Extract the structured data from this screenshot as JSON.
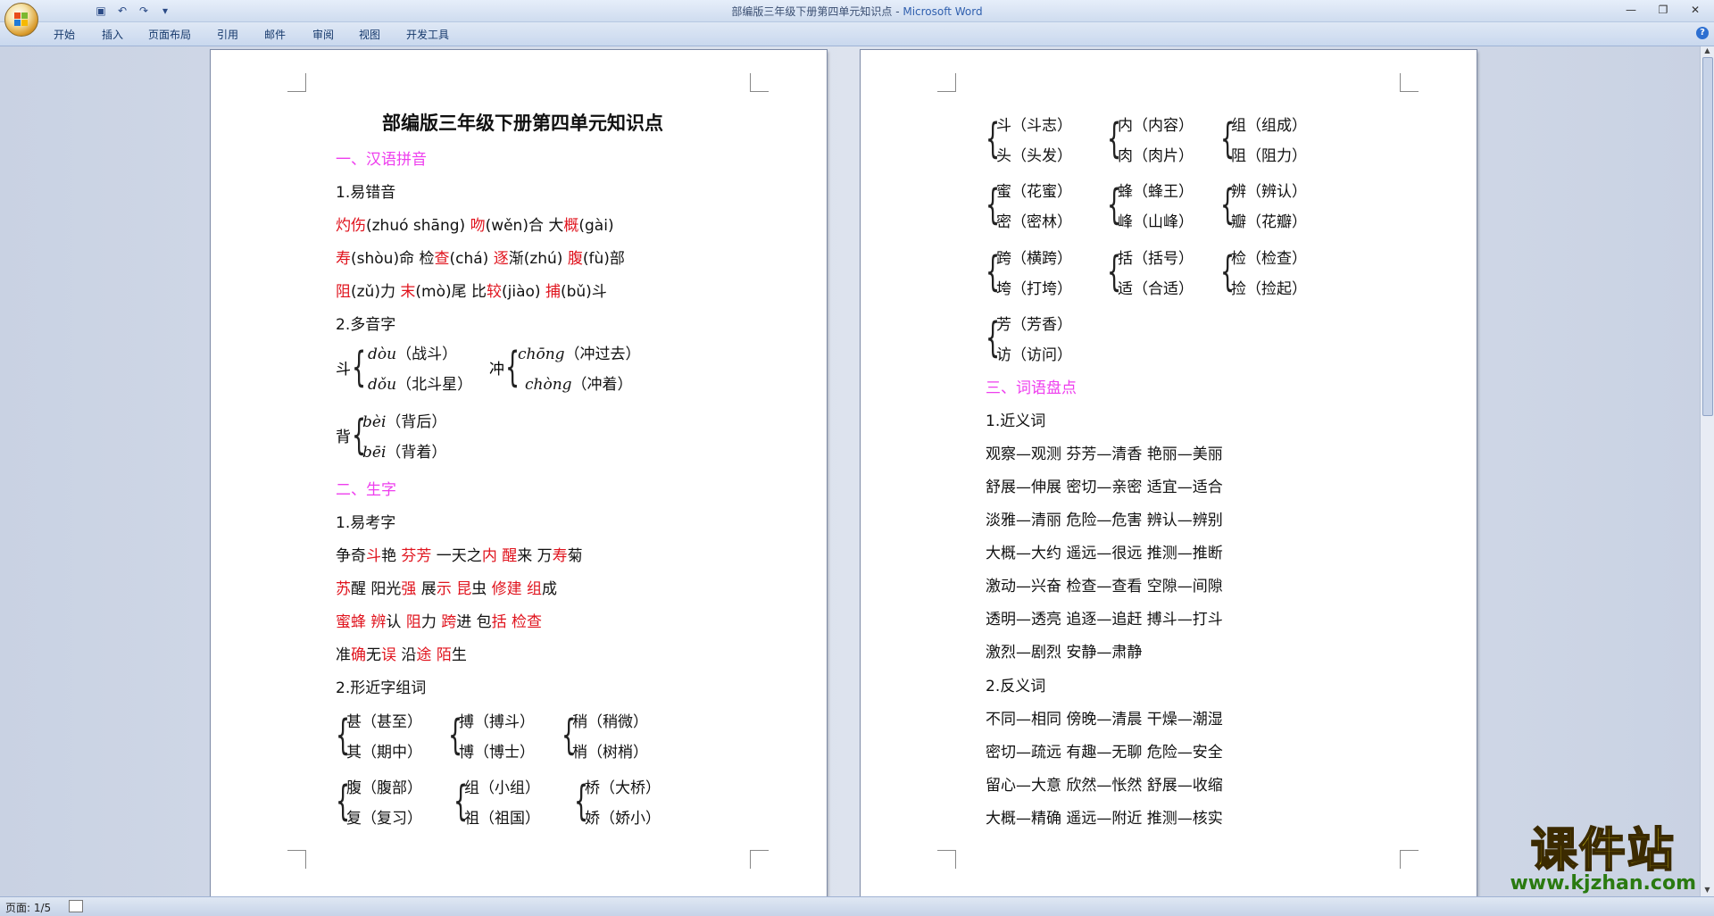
{
  "window": {
    "title": "部编版三年级下册第四单元知识点",
    "title_sep": " - ",
    "app_name": "Microsoft Word"
  },
  "quick_access": {
    "save_icon": "save-icon",
    "undo_icon": "undo-icon",
    "redo_icon": "redo-icon",
    "more": "▾"
  },
  "ribbon_tabs": [
    "开始",
    "插入",
    "页面布局",
    "引用",
    "邮件",
    "审阅",
    "视图",
    "开发工具"
  ],
  "page1": {
    "heading": "部编版三年级下册第四单元知识点",
    "s1": "一、汉语拼音",
    "s1_1": "1.易错音",
    "r1": [
      [
        "灼伤",
        "r"
      ],
      [
        "(zhuó shāng)   ",
        ""
      ],
      [
        "吻",
        "r"
      ],
      [
        "(wěn)合   大",
        ""
      ],
      [
        "概",
        "r"
      ],
      [
        "(gài)",
        ""
      ]
    ],
    "r2": [
      [
        "寿",
        "r"
      ],
      [
        "(shòu)命   检",
        ""
      ],
      [
        "查",
        "r"
      ],
      [
        "(chá)   ",
        ""
      ],
      [
        "逐",
        "r"
      ],
      [
        "渐(zhú)   ",
        ""
      ],
      [
        "腹",
        "r"
      ],
      [
        "(fù)部",
        ""
      ]
    ],
    "r3": [
      [
        "阻",
        "r"
      ],
      [
        "(zǔ)力   ",
        ""
      ],
      [
        "末",
        "r"
      ],
      [
        "(mò)尾   比",
        ""
      ],
      [
        "较",
        "r"
      ],
      [
        "(jiào)   ",
        ""
      ],
      [
        "捕",
        "r"
      ],
      [
        "(bǔ)斗",
        ""
      ]
    ],
    "s1_2": "2.多音字",
    "poly": [
      {
        "prefix": "斗",
        "a": "dòu",
        "a_word": "（战斗）",
        "b": "dǒu",
        "b_word": "（北斗星）"
      },
      {
        "prefix": "冲",
        "a": "chōng",
        "a_word": "（冲过去）",
        "b": "chòng",
        "b_word": "（冲着）"
      },
      {
        "prefix": "背",
        "a": "bèi",
        "a_word": "（背后）",
        "b": "bēi",
        "b_word": "（背着）"
      }
    ],
    "s2": "二、生字",
    "s2_1": "1.易考字",
    "k1": [
      [
        "争奇",
        ""
      ],
      [
        "斗",
        "r"
      ],
      [
        "艳   ",
        ""
      ],
      [
        "芬芳",
        "r"
      ],
      [
        "   一天之",
        ""
      ],
      [
        "内",
        "r"
      ],
      [
        "   ",
        ""
      ],
      [
        "醒",
        "r"
      ],
      [
        "来   万",
        ""
      ],
      [
        "寿",
        "r"
      ],
      [
        "菊",
        ""
      ]
    ],
    "k2": [
      [
        "苏",
        "r"
      ],
      [
        "醒   阳光",
        ""
      ],
      [
        "强",
        "r"
      ],
      [
        "   展",
        ""
      ],
      [
        "示",
        "r"
      ],
      [
        "   ",
        ""
      ],
      [
        "昆",
        "r"
      ],
      [
        "虫   ",
        ""
      ],
      [
        "修建",
        "r"
      ],
      [
        "   ",
        ""
      ],
      [
        "组",
        "r"
      ],
      [
        "成",
        ""
      ]
    ],
    "k3": [
      [
        "蜜蜂",
        "r"
      ],
      [
        "   ",
        ""
      ],
      [
        "辨",
        "r"
      ],
      [
        "认   ",
        ""
      ],
      [
        "阻",
        "r"
      ],
      [
        "力   ",
        ""
      ],
      [
        "跨",
        "r"
      ],
      [
        "进   包",
        ""
      ],
      [
        "括",
        "r"
      ],
      [
        "   ",
        ""
      ],
      [
        "检查",
        "r"
      ]
    ],
    "k4": [
      [
        "准",
        ""
      ],
      [
        "确",
        "r"
      ],
      [
        "无",
        ""
      ],
      [
        "误",
        "r"
      ],
      [
        "   沿",
        ""
      ],
      [
        "途",
        "r"
      ],
      [
        "   ",
        ""
      ],
      [
        "陌",
        "r"
      ],
      [
        "生",
        ""
      ]
    ],
    "s2_2": "2.形近字组词",
    "similar1": [
      {
        "a": "甚（甚至）",
        "b": "其（期中）"
      },
      {
        "a": "搏（搏斗）",
        "b": "博（博士）"
      },
      {
        "a": "稍（稍微）",
        "b": "梢（树梢）"
      }
    ],
    "similar2": [
      {
        "a": "腹（腹部）",
        "b": "复（复习）"
      },
      {
        "a": "组（小组）",
        "b": "祖（祖国）"
      },
      {
        "a": "桥（大桥）",
        "b": "娇（娇小）"
      }
    ]
  },
  "page2": {
    "groups": [
      [
        {
          "a": "斗（斗志）",
          "b": "头（头发）"
        },
        {
          "a": "内（内容）",
          "b": "肉（肉片）"
        },
        {
          "a": "组（组成）",
          "b": "阻（阻力）"
        }
      ],
      [
        {
          "a": "蜜（花蜜）",
          "b": "密（密林）"
        },
        {
          "a": "蜂（蜂王）",
          "b": "峰（山峰）"
        },
        {
          "a": "辨（辨认）",
          "b": "瓣（花瓣）"
        }
      ],
      [
        {
          "a": "跨（横跨）",
          "b": "垮（打垮）"
        },
        {
          "a": "括（括号）",
          "b": "适（合适）"
        },
        {
          "a": "检（检查）",
          "b": "捡（捡起）"
        }
      ],
      [
        {
          "a": "芳（芳香）",
          "b": "访（访问）"
        }
      ]
    ],
    "s3": "三、词语盘点",
    "s3_1": "1.近义词",
    "syn": [
      "观察—观测   芬芳—清香   艳丽—美丽",
      "舒展—伸展   密切—亲密   适宜—适合",
      "淡雅—清丽   危险—危害   辨认—辨别",
      "大概—大约   遥远—很远   推测—推断",
      "激动—兴奋   检查—查看   空隙—间隙",
      "透明—透亮   追逐—追赶   搏斗—打斗",
      "激烈—剧烈   安静—肃静"
    ],
    "s3_2": "2.反义词",
    "ant": [
      "不同—相同   傍晚—清晨   干燥—潮湿",
      "密切—疏远   有趣—无聊   危险—安全",
      "留心—大意   欣然—怅然   舒展—收缩",
      "大概—精确   遥远—附近   推测—核实"
    ]
  },
  "status": {
    "page_info": "页面: 1/5"
  },
  "watermark": {
    "text": "课件站",
    "url": "www.kjzhan.com"
  },
  "colors": {
    "red": "#e0141e",
    "section": "#ee3eee",
    "accent": "#2f5fae"
  }
}
